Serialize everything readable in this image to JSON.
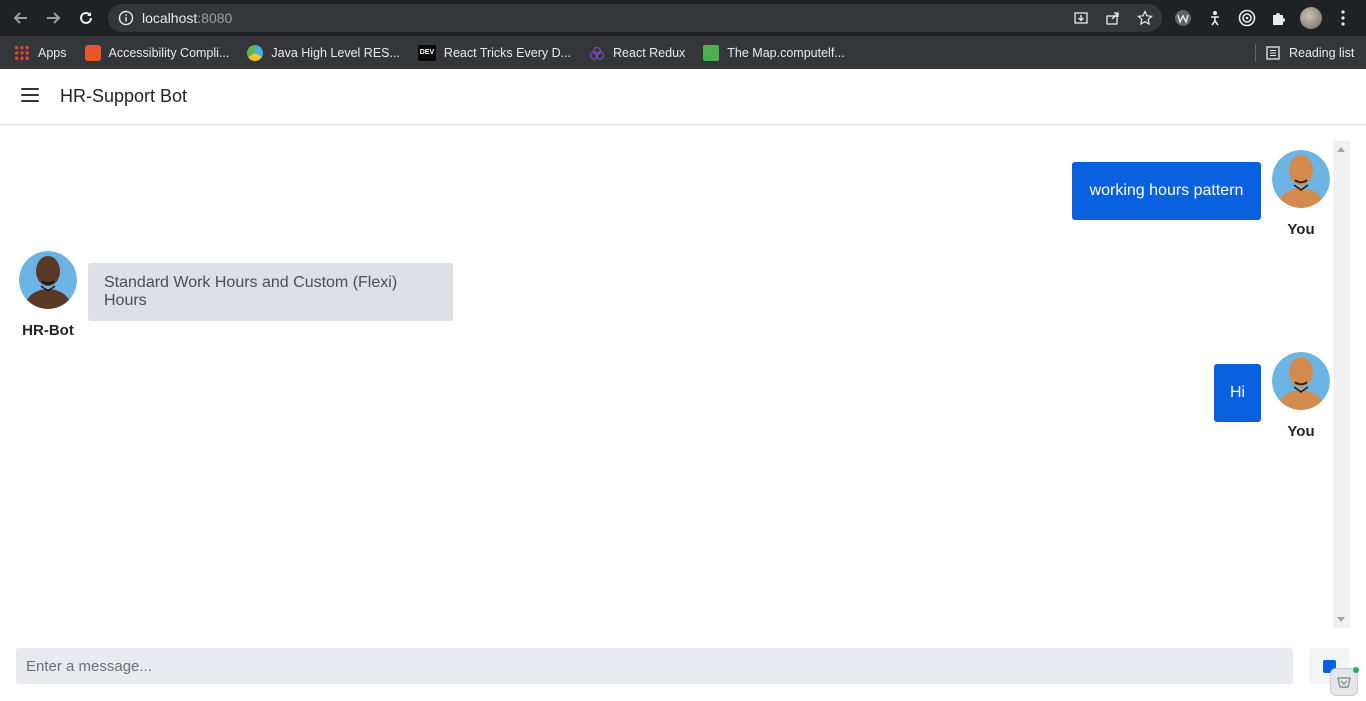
{
  "browser": {
    "url_host": "localhost",
    "url_port": ":8080",
    "bookmarks": [
      {
        "label": "Apps",
        "color": "#ea4335"
      },
      {
        "label": "Accessibility Compli...",
        "color": "#e8572a"
      },
      {
        "label": "Java High Level RES...",
        "color": "#3fb4e5"
      },
      {
        "label": "React Tricks Every D...",
        "color": "#0a0a0a"
      },
      {
        "label": "React Redux",
        "color": "#764abc"
      },
      {
        "label": "The Map.computelf...",
        "color": "#4caf50"
      }
    ],
    "reading_list": "Reading list"
  },
  "app": {
    "title": "HR-Support Bot"
  },
  "chat": {
    "messages": [
      {
        "sender": "user",
        "text": "working hours pattern",
        "name": "You"
      },
      {
        "sender": "bot",
        "text": "Standard Work Hours and Custom (Flexi) Hours",
        "name": "HR-Bot"
      },
      {
        "sender": "user",
        "text": "Hi",
        "name": "You"
      }
    ]
  },
  "composer": {
    "placeholder": "Enter a message..."
  },
  "colors": {
    "user_bubble": "#0860df",
    "bot_bubble": "#dde0e4",
    "avatar_bg": "#6cb4e4"
  }
}
